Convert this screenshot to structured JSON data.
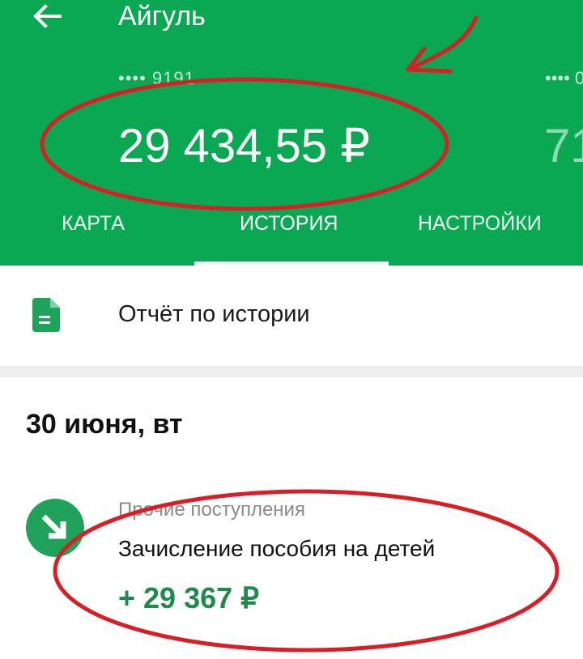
{
  "header": {
    "title": "Айгуль",
    "card_number": "•••• 9191",
    "balance": "29 434,55 ₽",
    "next_card_number": "•••• 0",
    "next_balance": "71"
  },
  "tabs": [
    {
      "label": "КАРТА"
    },
    {
      "label": "ИСТОРИЯ"
    },
    {
      "label": "НАСТРОЙКИ"
    }
  ],
  "report": {
    "label": "Отчёт по истории"
  },
  "history": {
    "date": "30 июня, вт",
    "transaction": {
      "category": "Прочие поступления",
      "description": "Зачисление пособия на детей",
      "amount": "+ 29 367 ₽"
    }
  },
  "colors": {
    "brand": "#0aa852",
    "positive_amount": "#1f8a4c",
    "annotation": "#d81f26"
  }
}
